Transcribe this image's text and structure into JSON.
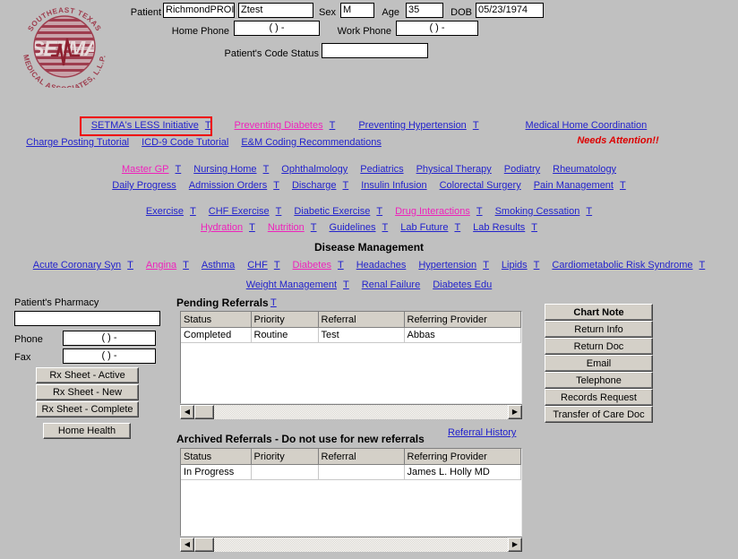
{
  "logo": {
    "top_arc": "SOUTHEAST TEXAS",
    "bottom_arc": "MEDICAL ASSOCIATES, L.L.P.",
    "center": "SETMA",
    "brand_color": "#9e3d4e"
  },
  "header": {
    "patient_label": "Patient",
    "patient_last": "RichmondPROI",
    "patient_first": "Ztest",
    "sex_label": "Sex",
    "sex": "M",
    "age_label": "Age",
    "age": "35",
    "dob_label": "DOB",
    "dob": "05/23/1974",
    "home_phone_label": "Home Phone",
    "home_phone": "(   )   -",
    "work_phone_label": "Work Phone",
    "work_phone": "(   )   -",
    "code_status_label": "Patient's Code Status",
    "code_status": ""
  },
  "nav": {
    "t_marker": "T",
    "row1": [
      {
        "label": "SETMA's LESS Initiative",
        "color": "blue",
        "t": true,
        "highlighted": true
      },
      {
        "label": "Preventing Diabetes",
        "color": "magenta",
        "t": true
      },
      {
        "label": "Preventing Hypertension",
        "color": "blue",
        "t": true
      },
      {
        "label": "Medical Home Coordination",
        "color": "blue",
        "t": false
      }
    ],
    "needs_attention": "Needs Attention!!",
    "row2": [
      {
        "label": "Charge Posting Tutorial",
        "color": "blue",
        "t": false
      },
      {
        "label": "ICD-9 Code Tutorial",
        "color": "blue",
        "t": false
      },
      {
        "label": "E&M Coding Recommendations",
        "color": "blue",
        "t": false
      }
    ],
    "row3": [
      {
        "label": "Master GP",
        "color": "magenta",
        "t": true
      },
      {
        "label": "Nursing Home",
        "color": "blue",
        "t": true
      },
      {
        "label": "Ophthalmology",
        "color": "blue",
        "t": false
      },
      {
        "label": "Pediatrics",
        "color": "blue",
        "t": false
      },
      {
        "label": "Physical Therapy",
        "color": "blue",
        "t": false
      },
      {
        "label": "Podiatry",
        "color": "blue",
        "t": false
      },
      {
        "label": "Rheumatology",
        "color": "blue",
        "t": false
      }
    ],
    "row4": [
      {
        "label": "Daily Progress",
        "color": "blue",
        "t": false
      },
      {
        "label": "Admission Orders",
        "color": "blue",
        "t": true
      },
      {
        "label": "Discharge",
        "color": "blue",
        "t": true
      },
      {
        "label": "Insulin Infusion",
        "color": "blue",
        "t": false
      },
      {
        "label": "Colorectal Surgery",
        "color": "blue",
        "t": false
      },
      {
        "label": "Pain Management",
        "color": "blue",
        "t": true
      }
    ],
    "row5": [
      {
        "label": "Exercise",
        "color": "blue",
        "t": true
      },
      {
        "label": "CHF Exercise",
        "color": "blue",
        "t": true
      },
      {
        "label": "Diabetic Exercise",
        "color": "blue",
        "t": true
      },
      {
        "label": "Drug Interactions",
        "color": "magenta",
        "t": true
      },
      {
        "label": "Smoking Cessation",
        "color": "blue",
        "t": true
      }
    ],
    "row6": [
      {
        "label": "Hydration",
        "color": "magenta",
        "t": true
      },
      {
        "label": "Nutrition",
        "color": "magenta",
        "t": true
      },
      {
        "label": "Guidelines",
        "color": "blue",
        "t": true
      },
      {
        "label": "Lab Future",
        "color": "blue",
        "t": true
      },
      {
        "label": "Lab Results",
        "color": "blue",
        "t": true
      }
    ],
    "disease_management_title": "Disease Management",
    "row7": [
      {
        "label": "Acute Coronary Syn",
        "color": "blue",
        "t": true
      },
      {
        "label": "Angina",
        "color": "magenta",
        "t": true
      },
      {
        "label": "Asthma",
        "color": "blue",
        "t": false
      },
      {
        "label": "CHF",
        "color": "blue",
        "t": true
      },
      {
        "label": "Diabetes",
        "color": "magenta",
        "t": true
      },
      {
        "label": "Headaches",
        "color": "blue",
        "t": false
      },
      {
        "label": "Hypertension",
        "color": "blue",
        "t": true
      },
      {
        "label": "Lipids",
        "color": "blue",
        "t": true
      },
      {
        "label": "Cardiometabolic Risk Syndrome",
        "color": "blue",
        "t": true
      }
    ],
    "row8": [
      {
        "label": "Weight Management",
        "color": "blue",
        "t": true
      },
      {
        "label": "Renal Failure",
        "color": "blue",
        "t": false
      },
      {
        "label": "Diabetes Edu",
        "color": "blue",
        "t": false
      }
    ]
  },
  "pharmacy": {
    "title": "Patient's Pharmacy",
    "name": "",
    "phone_label": "Phone",
    "phone": "(   )   -",
    "fax_label": "Fax",
    "fax": "(   )   -",
    "buttons": [
      "Rx Sheet - Active",
      "Rx Sheet - New",
      "Rx Sheet - Complete"
    ],
    "home_health": "Home Health"
  },
  "pending_referrals": {
    "title": "Pending Referrals",
    "t_marker": "T",
    "columns": [
      "Status",
      "Priority",
      "Referral",
      "Referring Provider"
    ],
    "rows": [
      [
        "Completed",
        "Routine",
        "Test",
        "Abbas"
      ]
    ]
  },
  "archived_referrals": {
    "title": "Archived Referrals - Do not use for new referrals",
    "history_link": "Referral History",
    "columns": [
      "Status",
      "Priority",
      "Referral",
      "Referring Provider"
    ],
    "rows": [
      [
        "In Progress",
        "",
        "",
        "James L. Holly MD"
      ]
    ]
  },
  "actions": {
    "buttons": [
      {
        "label": "Chart Note",
        "bold": true
      },
      {
        "label": "Return Info",
        "bold": false
      },
      {
        "label": "Return Doc",
        "bold": false
      },
      {
        "label": "Email",
        "bold": false
      },
      {
        "label": "Telephone",
        "bold": false
      },
      {
        "label": "Records Request",
        "bold": false
      },
      {
        "label": "Transfer of Care Doc",
        "bold": false
      }
    ]
  },
  "colors": {
    "background": "#c0c0c0",
    "link": "#2222cc",
    "link_visited": "#ee22bb",
    "alert": "#dd0000",
    "button_face": "#d4d0c8"
  }
}
